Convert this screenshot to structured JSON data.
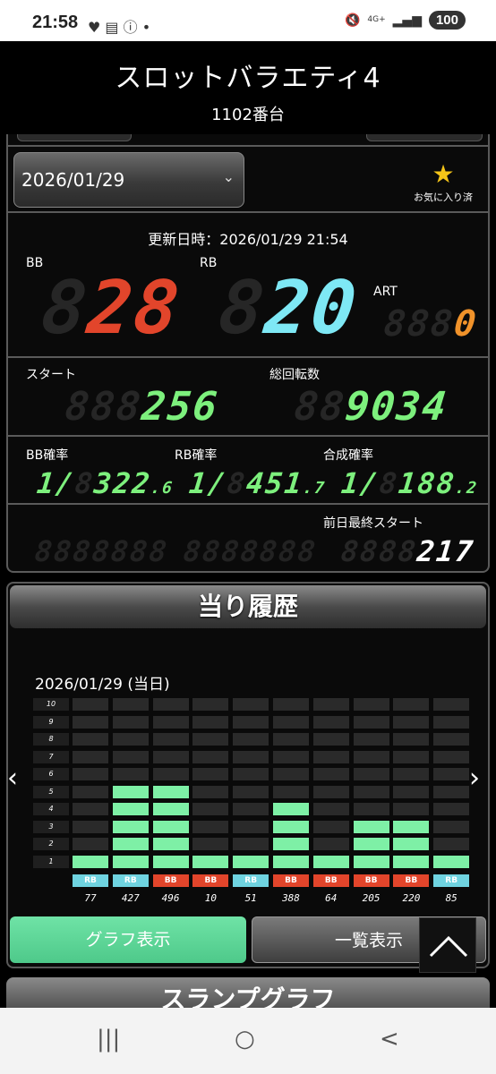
{
  "status": {
    "time": "21:58",
    "left_icons": "♥ ▤ ⓘ •",
    "net": "4G+",
    "battery": "100"
  },
  "header": {
    "title": "スロットバラエティ4",
    "machine": "1102番台"
  },
  "date_select": {
    "value": "2026/01/29",
    "chevron": "⌄"
  },
  "favorite": {
    "icon": "star-icon",
    "label": "お気に入り済"
  },
  "updated": "更新日時：2026/01/29 21:54",
  "counts": {
    "bb_label": "BB",
    "bb_value": "28",
    "rb_label": "RB",
    "rb_value": "20",
    "art_label": "ART",
    "art_value": "0"
  },
  "spins": {
    "start_label": "スタート",
    "start_value": "256",
    "total_label": "総回転数",
    "total_value": "9034"
  },
  "probs": {
    "bb_label": "BB確率",
    "bb_int": "322",
    "bb_dec": ".6",
    "rb_label": "RB確率",
    "rb_int": "451",
    "rb_dec": ".7",
    "comb_label": "合成確率",
    "comb_int": "188",
    "comb_dec": ".2",
    "prefix": "1/"
  },
  "prev": {
    "label": "前日最終スタート",
    "value": "217"
  },
  "history": {
    "title": "当り履歴",
    "date": "2026/01/29 (当日)",
    "y_labels": [
      "10",
      "9",
      "8",
      "7",
      "6",
      "5",
      "4",
      "3",
      "2",
      "1"
    ],
    "bars": [
      {
        "type": "RB",
        "games": "77",
        "level": 1
      },
      {
        "type": "RB",
        "games": "427",
        "level": 5
      },
      {
        "type": "BB",
        "games": "496",
        "level": 5
      },
      {
        "type": "BB",
        "games": "10",
        "level": 1
      },
      {
        "type": "RB",
        "games": "51",
        "level": 1
      },
      {
        "type": "BB",
        "games": "388",
        "level": 4
      },
      {
        "type": "BB",
        "games": "64",
        "level": 1
      },
      {
        "type": "BB",
        "games": "205",
        "level": 3
      },
      {
        "type": "BB",
        "games": "220",
        "level": 3
      },
      {
        "type": "RB",
        "games": "85",
        "level": 1
      }
    ],
    "graph_btn": "グラフ表示",
    "list_btn": "一覧表示"
  },
  "slump": {
    "title": "スランプグラフ"
  },
  "nav": {
    "recent": "|||",
    "home": "○",
    "back": "<"
  }
}
